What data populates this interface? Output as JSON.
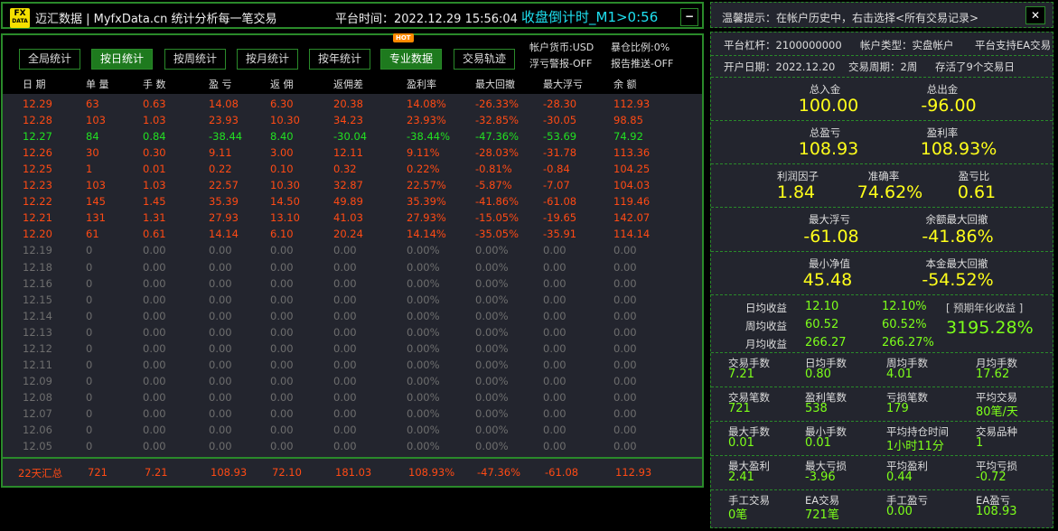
{
  "title": {
    "logo": "FX",
    "logo_sub": "DATA",
    "app": "迈汇数据 | MyfxData.cn  统计分析每一笔交易",
    "platform_time": "平台时间：2022.12.29 15:56:04",
    "countdown": "收盘倒计时_M1>0:56",
    "minimize": "−"
  },
  "toolbar": {
    "buttons": [
      "全局统计",
      "按日统计",
      "按周统计",
      "按月统计",
      "按年统计",
      "专业数据",
      "交易轨迹"
    ],
    "active": 1,
    "hot_badge": "HOT",
    "options": [
      "帐户货币:USD",
      "暴仓比例:0%",
      "浮亏警报-OFF",
      "报告推送-OFF"
    ]
  },
  "table": {
    "headers": [
      "日 期",
      "单 量",
      "手 数",
      "盈 亏",
      "返 佣",
      "返佣差",
      "盈利率",
      "最大回撤",
      "最大浮亏",
      "余 额"
    ],
    "rows": [
      [
        "12.29",
        "63",
        "0.63",
        "14.08",
        "6.30",
        "20.38",
        "14.08%",
        "-26.33%",
        "-28.30",
        "112.93"
      ],
      [
        "12.28",
        "103",
        "1.03",
        "23.93",
        "10.30",
        "34.23",
        "23.93%",
        "-32.85%",
        "-30.05",
        "98.85"
      ],
      [
        "12.27",
        "84",
        "0.84",
        "-38.44",
        "8.40",
        "-30.04",
        "-38.44%",
        "-47.36%",
        "-53.69",
        "74.92"
      ],
      [
        "12.26",
        "30",
        "0.30",
        "9.11",
        "3.00",
        "12.11",
        "9.11%",
        "-28.03%",
        "-31.78",
        "113.36"
      ],
      [
        "12.25",
        "1",
        "0.01",
        "0.22",
        "0.10",
        "0.32",
        "0.22%",
        "-0.81%",
        "-0.84",
        "104.25"
      ],
      [
        "12.23",
        "103",
        "1.03",
        "22.57",
        "10.30",
        "32.87",
        "22.57%",
        "-5.87%",
        "-7.07",
        "104.03"
      ],
      [
        "12.22",
        "145",
        "1.45",
        "35.39",
        "14.50",
        "49.89",
        "35.39%",
        "-41.86%",
        "-61.08",
        "119.46"
      ],
      [
        "12.21",
        "131",
        "1.31",
        "27.93",
        "13.10",
        "41.03",
        "27.93%",
        "-15.05%",
        "-19.65",
        "142.07"
      ],
      [
        "12.20",
        "61",
        "0.61",
        "14.14",
        "6.10",
        "20.24",
        "14.14%",
        "-35.05%",
        "-35.91",
        "114.14"
      ],
      [
        "12.19",
        "0",
        "0.00",
        "0.00",
        "0.00",
        "0.00",
        "0.00%",
        "0.00%",
        "0.00",
        "0.00"
      ],
      [
        "12.18",
        "0",
        "0.00",
        "0.00",
        "0.00",
        "0.00",
        "0.00%",
        "0.00%",
        "0.00",
        "0.00"
      ],
      [
        "12.16",
        "0",
        "0.00",
        "0.00",
        "0.00",
        "0.00",
        "0.00%",
        "0.00%",
        "0.00",
        "0.00"
      ],
      [
        "12.15",
        "0",
        "0.00",
        "0.00",
        "0.00",
        "0.00",
        "0.00%",
        "0.00%",
        "0.00",
        "0.00"
      ],
      [
        "12.14",
        "0",
        "0.00",
        "0.00",
        "0.00",
        "0.00",
        "0.00%",
        "0.00%",
        "0.00",
        "0.00"
      ],
      [
        "12.13",
        "0",
        "0.00",
        "0.00",
        "0.00",
        "0.00",
        "0.00%",
        "0.00%",
        "0.00",
        "0.00"
      ],
      [
        "12.12",
        "0",
        "0.00",
        "0.00",
        "0.00",
        "0.00",
        "0.00%",
        "0.00%",
        "0.00",
        "0.00"
      ],
      [
        "12.11",
        "0",
        "0.00",
        "0.00",
        "0.00",
        "0.00",
        "0.00%",
        "0.00%",
        "0.00",
        "0.00"
      ],
      [
        "12.09",
        "0",
        "0.00",
        "0.00",
        "0.00",
        "0.00",
        "0.00%",
        "0.00%",
        "0.00",
        "0.00"
      ],
      [
        "12.08",
        "0",
        "0.00",
        "0.00",
        "0.00",
        "0.00",
        "0.00%",
        "0.00%",
        "0.00",
        "0.00"
      ],
      [
        "12.07",
        "0",
        "0.00",
        "0.00",
        "0.00",
        "0.00",
        "0.00%",
        "0.00%",
        "0.00",
        "0.00"
      ],
      [
        "12.06",
        "0",
        "0.00",
        "0.00",
        "0.00",
        "0.00",
        "0.00%",
        "0.00%",
        "0.00",
        "0.00"
      ],
      [
        "12.05",
        "0",
        "0.00",
        "0.00",
        "0.00",
        "0.00",
        "0.00%",
        "0.00%",
        "0.00",
        "0.00"
      ]
    ],
    "row_status": [
      "profit",
      "profit",
      "loss",
      "profit",
      "profit",
      "profit",
      "profit",
      "profit",
      "profit",
      "none",
      "none",
      "none",
      "none",
      "none",
      "none",
      "none",
      "none",
      "none",
      "none",
      "none",
      "none",
      "none"
    ],
    "footer": [
      "22天汇总",
      "721",
      "7.21",
      "108.93",
      "72.10",
      "181.03",
      "108.93%",
      "-47.36%",
      "-61.08",
      "112.93"
    ]
  },
  "colors": {
    "profit": "#ff4a14",
    "loss": "#22e022",
    "none": "#6e6e6e",
    "border": "#2a8a2a",
    "highlight": "#ffff1a",
    "green_value": "#7dff1a"
  },
  "tip": {
    "text": "温馨提示：在帐户历史中，右击选择<所有交易记录>",
    "close": "✕"
  },
  "account": {
    "leverage": "平台杠杆：2100000000",
    "type": "帐户类型：实盘帐户",
    "ea": "平台支持EA交易",
    "open_date": "开户日期：2022.12.20",
    "period": "交易周期：2周",
    "alive": "存活了9个交易日"
  },
  "summary": {
    "deposit_label": "总入金",
    "deposit": "100.00",
    "withdraw_label": "总出金",
    "withdraw": "-96.00",
    "pl_label": "总盈亏",
    "pl": "108.93",
    "rate_label": "盈利率",
    "rate": "108.93%",
    "pf_label": "利润因子",
    "pf": "1.84",
    "acc_label": "准确率",
    "acc": "74.62%",
    "ratio_label": "盈亏比",
    "ratio": "0.61",
    "maxfloat_label": "最大浮亏",
    "maxfloat": "-61.08",
    "baldd_label": "余额最大回撤",
    "baldd": "-41.86%",
    "mineq_label": "最小净值",
    "mineq": "45.48",
    "capdd_label": "本金最大回撤",
    "capdd": "-54.52%"
  },
  "returns": {
    "rows": [
      [
        "日均收益",
        "12.10",
        "12.10%"
      ],
      [
        "周均收益",
        "60.52",
        "60.52%"
      ],
      [
        "月均收益",
        "266.27",
        "266.27%"
      ]
    ],
    "annual_label": "[ 预期年化收益 ]",
    "annual": "3195.28%"
  },
  "stats": [
    [
      [
        "交易手数",
        "7.21"
      ],
      [
        "日均手数",
        "0.80"
      ],
      [
        "周均手数",
        "4.01"
      ],
      [
        "月均手数",
        "17.62"
      ]
    ],
    [
      [
        "交易笔数",
        "721"
      ],
      [
        "盈利笔数",
        "538"
      ],
      [
        "亏损笔数",
        "179"
      ],
      [
        "平均交易",
        "80笔/天"
      ]
    ],
    [
      [
        "最大手数",
        "0.01"
      ],
      [
        "最小手数",
        "0.01"
      ],
      [
        "平均持仓时间",
        "1小时11分"
      ],
      [
        "交易品种",
        "1"
      ]
    ],
    [
      [
        "最大盈利",
        "2.41"
      ],
      [
        "最大亏损",
        "-3.96"
      ],
      [
        "平均盈利",
        "0.44"
      ],
      [
        "平均亏损",
        "-0.72"
      ]
    ],
    [
      [
        "手工交易",
        "0笔"
      ],
      [
        "EA交易",
        "721笔"
      ],
      [
        "手工盈亏",
        "0.00"
      ],
      [
        "EA盈亏",
        "108.93"
      ]
    ]
  ]
}
